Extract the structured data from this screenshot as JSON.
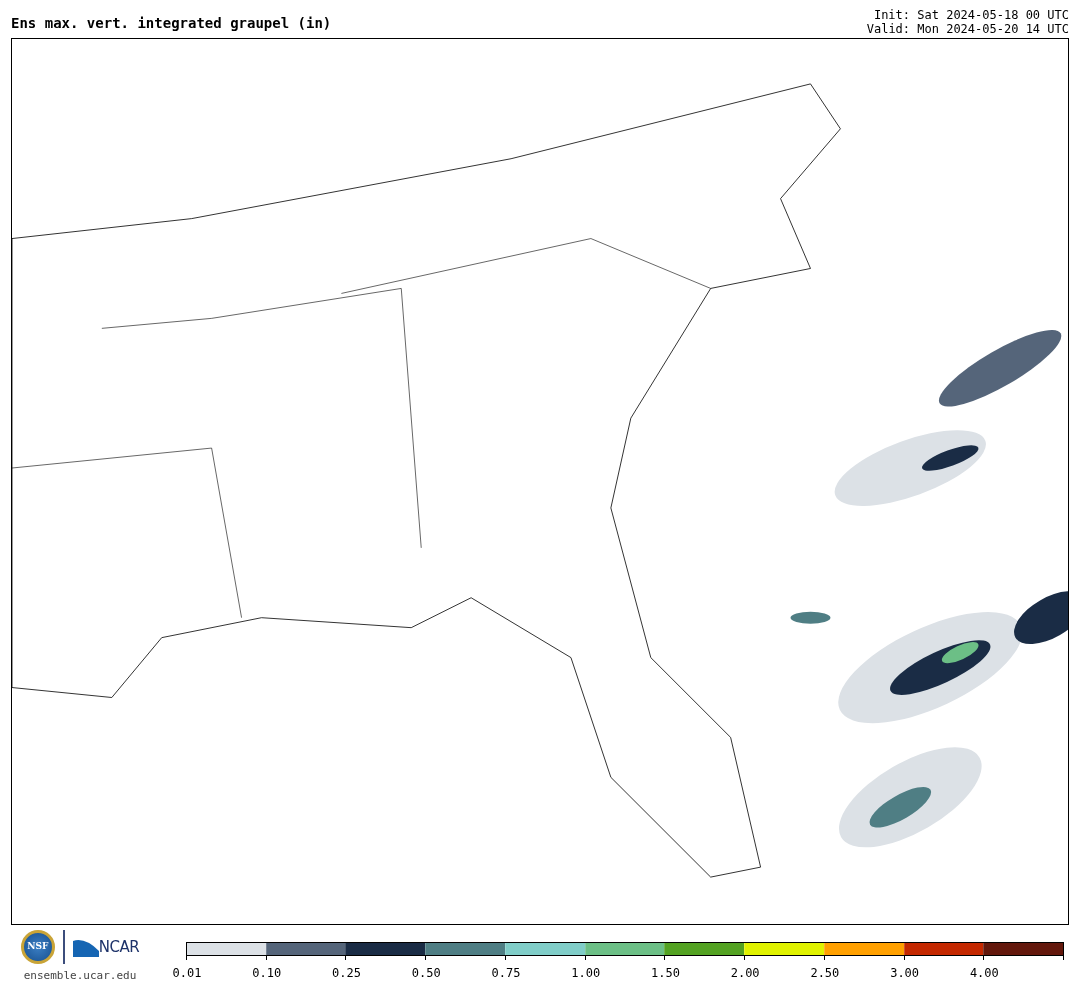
{
  "header": {
    "title": "Ens max. vert. integrated graupel (in)",
    "init": "Init: Sat 2024-05-18 00 UTC",
    "valid": "Valid: Mon 2024-05-20 14 UTC"
  },
  "footer": {
    "nsf_logo": "NSF",
    "ncar_logo": "NCAR",
    "url": "ensemble.ucar.edu"
  },
  "colorbar": [
    {
      "label": "0.01",
      "color": "#dce1e6"
    },
    {
      "label": "0.10",
      "color": "#55657a"
    },
    {
      "label": "0.25",
      "color": "#1a2c45"
    },
    {
      "label": "0.50",
      "color": "#4f7e84"
    },
    {
      "label": "0.75",
      "color": "#80cdc8"
    },
    {
      "label": "1.00",
      "color": "#6cbf86"
    },
    {
      "label": "1.50",
      "color": "#53a222"
    },
    {
      "label": "2.00",
      "color": "#e0f200"
    },
    {
      "label": "2.50",
      "color": "#ffa000"
    },
    {
      "label": "3.00",
      "color": "#c42800"
    },
    {
      "label": "4.00",
      "color": "#63180c"
    }
  ]
}
